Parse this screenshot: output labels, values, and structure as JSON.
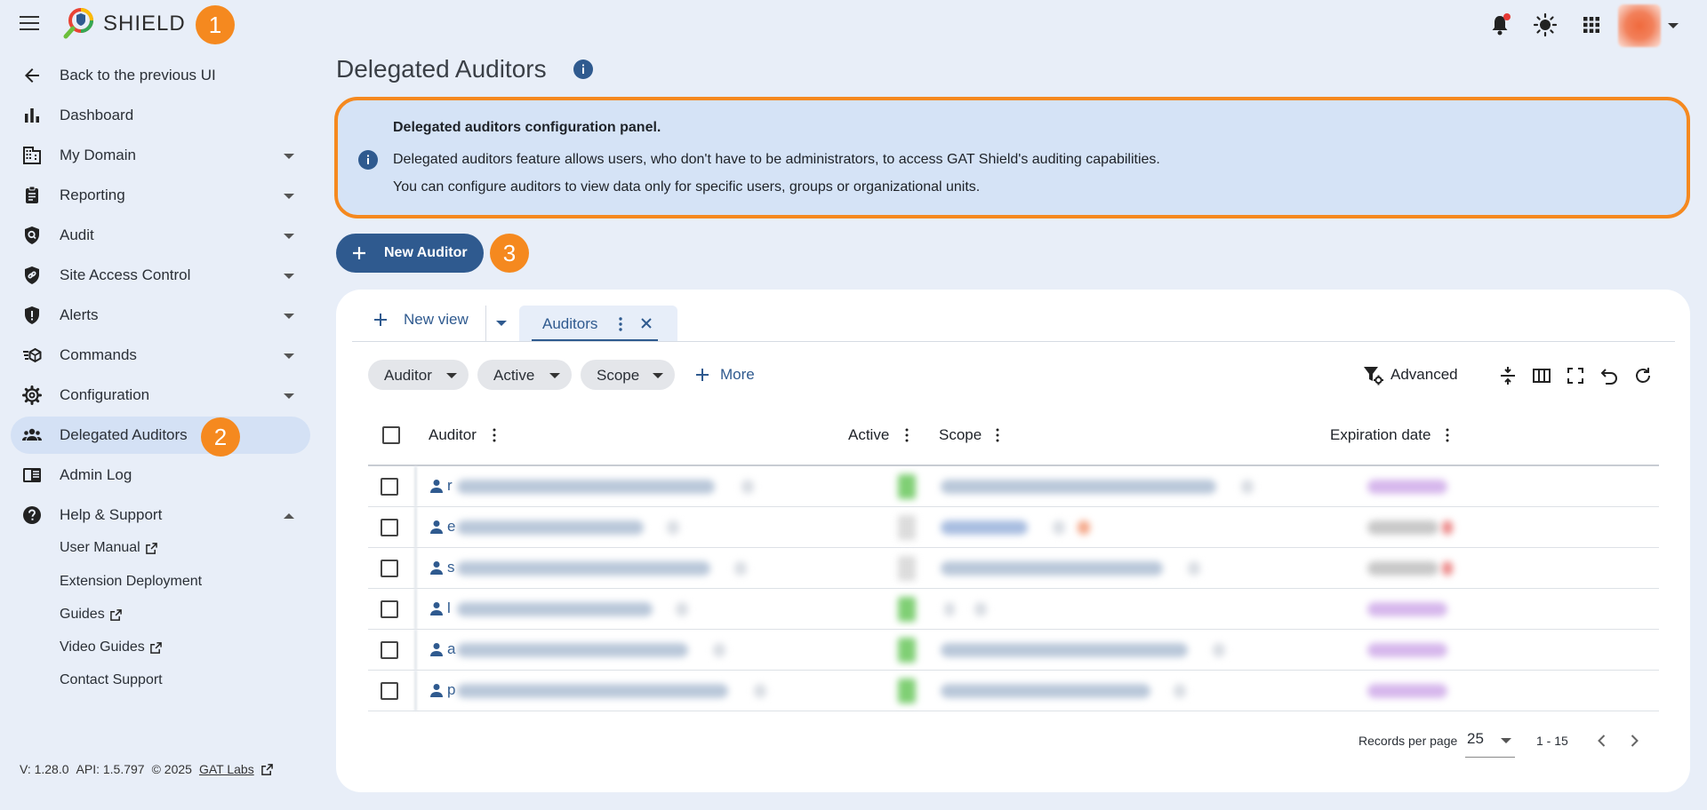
{
  "app": {
    "brand": "SHIELD",
    "step_badges": [
      "1",
      "2",
      "3"
    ]
  },
  "sidebar": {
    "back": "Back to the previous UI",
    "items": [
      {
        "label": "Dashboard",
        "icon": "bar-chart-icon"
      },
      {
        "label": "My Domain",
        "icon": "building-icon"
      },
      {
        "label": "Reporting",
        "icon": "clipboard-icon"
      },
      {
        "label": "Audit",
        "icon": "audit-search-icon"
      },
      {
        "label": "Site Access Control",
        "icon": "shield-link-icon"
      },
      {
        "label": "Alerts",
        "icon": "alert-shield-icon"
      },
      {
        "label": "Commands",
        "icon": "commands-icon"
      },
      {
        "label": "Configuration",
        "icon": "gear-icon"
      },
      {
        "label": "Delegated Auditors",
        "icon": "people-icon"
      },
      {
        "label": "Admin Log",
        "icon": "log-icon"
      },
      {
        "label": "Help & Support",
        "icon": "help-icon"
      }
    ],
    "help_sub": [
      "User Manual",
      "Extension Deployment",
      "Guides",
      "Video Guides",
      "Contact Support"
    ],
    "footer": {
      "version": "V: 1.28.0",
      "api": "API: 1.5.797",
      "copyright": "© 2025",
      "link": "GAT Labs"
    }
  },
  "page": {
    "title": "Delegated Auditors",
    "info": {
      "heading": "Delegated auditors configuration panel.",
      "line1": "Delegated auditors feature allows users, who don't have to be administrators, to access GAT Shield's auditing capabilities.",
      "line2": "You can configure auditors to view data only for specific users, groups or organizational units."
    },
    "new_auditor": "New Auditor"
  },
  "views": {
    "new_view": "New view",
    "active_tab": "Auditors"
  },
  "filters": {
    "chips": [
      "Auditor",
      "Active",
      "Scope"
    ],
    "more": "More",
    "advanced": "Advanced"
  },
  "table": {
    "columns": [
      "Auditor",
      "Active",
      "Scope",
      "Expiration date"
    ],
    "rows": [
      {
        "lead": "r",
        "active": true,
        "expiry_status": "purple"
      },
      {
        "lead": "e",
        "active": false,
        "expiry_status": "red"
      },
      {
        "lead": "s",
        "active": false,
        "expiry_status": "red"
      },
      {
        "lead": "l",
        "active": true,
        "expiry_status": "purple"
      },
      {
        "lead": "a",
        "active": true,
        "expiry_status": "purple"
      },
      {
        "lead": "p",
        "active": true,
        "expiry_status": "purple"
      }
    ]
  },
  "pager": {
    "records_label": "Records per page",
    "per_page": "25",
    "range": "1 - 15"
  },
  "colors": {
    "accent": "#2f5a8f",
    "highlight": "#f5891f",
    "background": "#e8eef8",
    "info_bg": "#d5e3f6"
  }
}
